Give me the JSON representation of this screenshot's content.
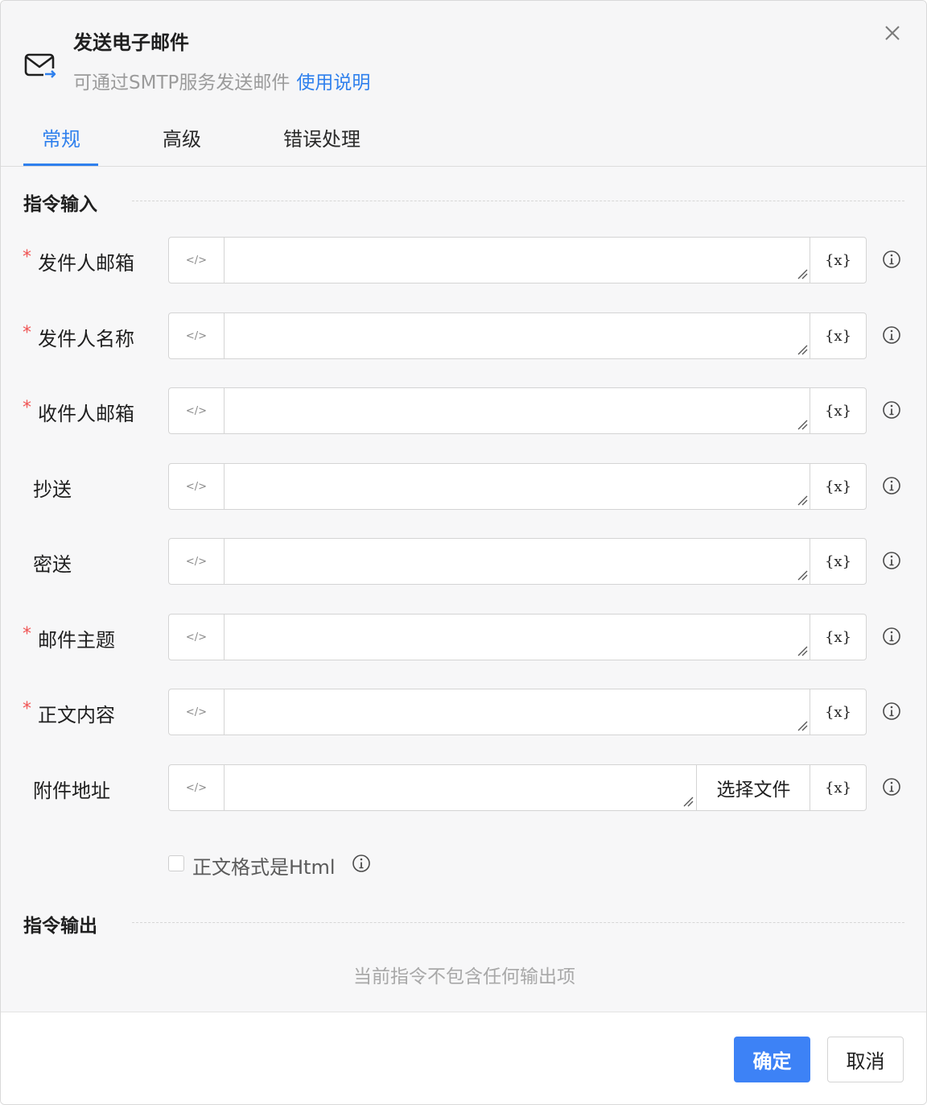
{
  "header": {
    "title": "发送电子邮件",
    "subtitle": "可通过SMTP服务发送邮件",
    "help_link": "使用说明",
    "icon": "mail-send-icon"
  },
  "tabs": [
    {
      "label": "常规",
      "active": true
    },
    {
      "label": "高级",
      "active": false
    },
    {
      "label": "错误处理",
      "active": false
    }
  ],
  "input_section": {
    "title": "指令输入",
    "fields": [
      {
        "label": "发件人邮箱",
        "required": true,
        "value": ""
      },
      {
        "label": "发件人名称",
        "required": true,
        "value": ""
      },
      {
        "label": "收件人邮箱",
        "required": true,
        "value": ""
      },
      {
        "label": "抄送",
        "required": false,
        "value": ""
      },
      {
        "label": "密送",
        "required": false,
        "value": ""
      },
      {
        "label": "邮件主题",
        "required": true,
        "value": ""
      },
      {
        "label": "正文内容",
        "required": true,
        "value": ""
      },
      {
        "label": "附件地址",
        "required": false,
        "value": ""
      }
    ],
    "required_mark": "*",
    "code_icon_text": "</>",
    "var_button_text": "{x}",
    "file_button": "选择文件",
    "html_checkbox": {
      "label": "正文格式是Html",
      "checked": false
    }
  },
  "output_section": {
    "title": "指令输出",
    "empty_text": "当前指令不包含任何输出项"
  },
  "footer": {
    "ok_label": "确定",
    "cancel_label": "取消"
  },
  "colors": {
    "accent": "#2f80ed",
    "primary_button": "#3d82f6",
    "required": "#f05454"
  }
}
